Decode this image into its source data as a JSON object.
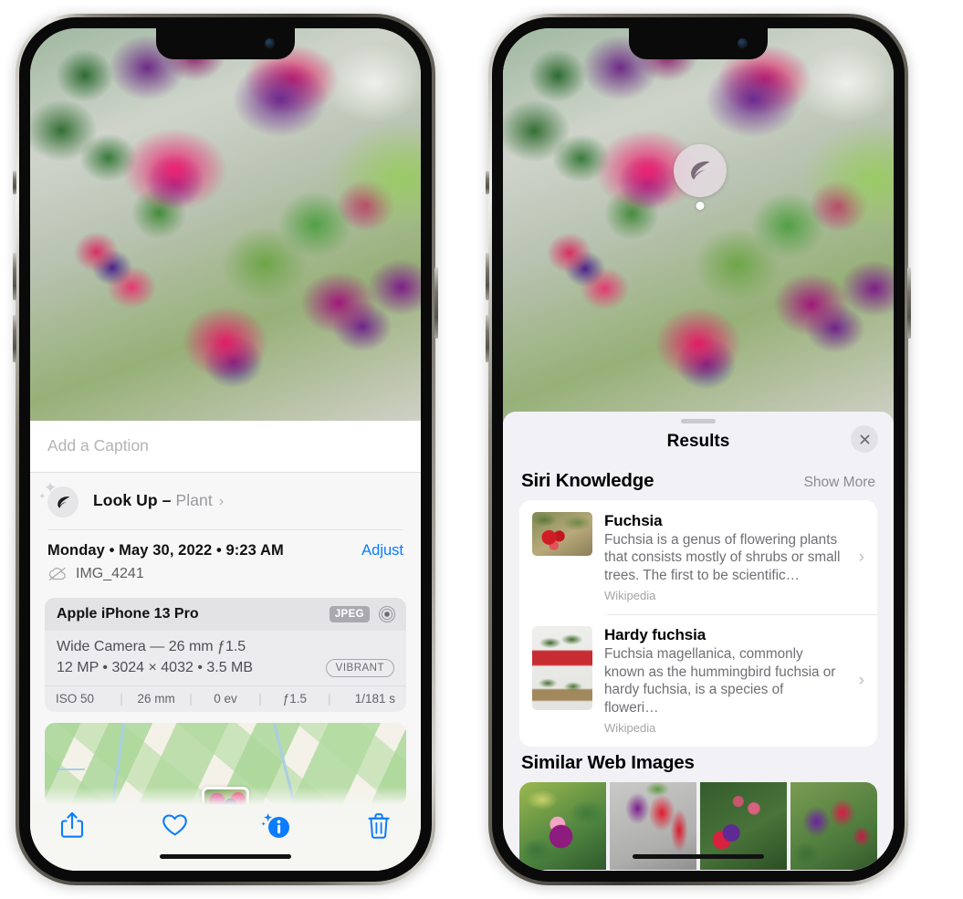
{
  "left_phone": {
    "caption": {
      "placeholder": "Add a Caption",
      "value": ""
    },
    "lookup": {
      "label": "Look Up –",
      "subject": "Plant",
      "chevron": "›",
      "icon": "leaf-icon"
    },
    "meta": {
      "date": "Monday • May 30, 2022 • 9:23 AM",
      "adjust": "Adjust",
      "filename": "IMG_4241",
      "cloud_icon": "icloud-slash-icon"
    },
    "camera_card": {
      "model": "Apple iPhone 13 Pro",
      "format_tag": "JPEG",
      "hdr_icon": "hdr-target-icon",
      "lens_line": "Wide Camera — 26 mm ƒ1.5",
      "size_line": "12 MP • 3024 × 4032 • 3.5 MB",
      "style_tag": "VIBRANT",
      "exif": [
        "ISO 50",
        "26 mm",
        "0 ev",
        "ƒ1.5",
        "1/181 s"
      ]
    },
    "toolbar": [
      {
        "name": "share-button",
        "icon": "share-icon"
      },
      {
        "name": "favorite-button",
        "icon": "heart-icon"
      },
      {
        "name": "info-button",
        "icon": "info-sparkle-icon"
      },
      {
        "name": "delete-button",
        "icon": "trash-icon"
      }
    ]
  },
  "right_phone": {
    "visual_lookup_badge": {
      "icon": "leaf-icon"
    },
    "sheet": {
      "title": "Results",
      "close_icon": "close-icon",
      "sections": [
        {
          "title": "Siri Knowledge",
          "action": "Show More",
          "items": [
            {
              "title": "Fuchsia",
              "description": "Fuchsia is a genus of flowering plants that consists mostly of shrubs or small trees. The first to be scientific…",
              "source": "Wikipedia",
              "chevron": "›"
            },
            {
              "title": "Hardy fuchsia",
              "description": "Fuchsia magellanica, commonly known as the hummingbird fuchsia or hardy fuchsia, is a species of floweri…",
              "source": "Wikipedia",
              "chevron": "›"
            }
          ]
        },
        {
          "title": "Similar Web Images",
          "images": [
            "web-image-1",
            "web-image-2",
            "web-image-3",
            "web-image-4"
          ]
        }
      ]
    }
  },
  "colors": {
    "accent_blue": "#0a7cff",
    "sheet_bg": "#f2f1f6",
    "card_bg": "#ffffff",
    "muted_text": "#6f6f75"
  }
}
